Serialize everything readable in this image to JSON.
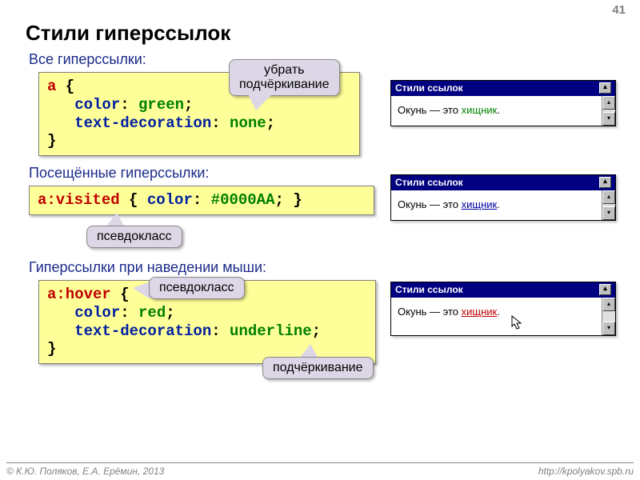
{
  "page_number": "41",
  "title": "Стили гиперссылок",
  "sections": {
    "all": {
      "heading": "Все гиперссылки:",
      "code_sel": "a",
      "code_brace_open": " {",
      "code_prop1": "   color",
      "code_sep": ": ",
      "code_val1": "green",
      "code_semicolon": ";",
      "code_prop2": "   text-decoration",
      "code_val2": "none",
      "code_brace_close": "}"
    },
    "visited": {
      "heading": "Посещённые гиперссылки:",
      "code_sel": "a:visited",
      "code_rest": " { color: #0000AA; }",
      "code_prop": "color",
      "code_val": "#0000AA"
    },
    "hover": {
      "heading": "Гиперссылки при наведении мыши:",
      "code_sel": "a:hover",
      "code_brace_open": " {",
      "code_prop1": "   color",
      "code_val1": "red",
      "code_prop2": "   text-decoration",
      "code_val2": "underline",
      "code_brace_close": "}"
    }
  },
  "callouts": {
    "remove_underline": "убрать\nподчёркивание",
    "pseudoclass1": "псевдокласс",
    "pseudoclass2": "псевдокласс",
    "underline": "подчёркивание"
  },
  "windows": {
    "title": "Стили ссылок",
    "text_prefix": "Окунь — это ",
    "link_text": "хищник",
    "period": "."
  },
  "footer": {
    "left": "© К.Ю. Поляков, Е.А. Ерёмин, 2013",
    "right": "http://kpolyakov.spb.ru"
  }
}
